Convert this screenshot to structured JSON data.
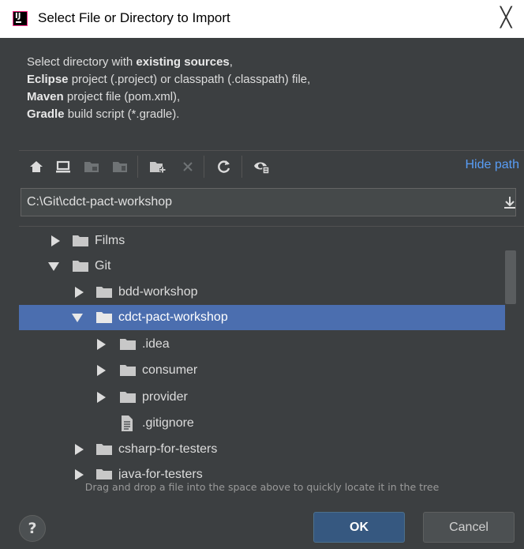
{
  "window": {
    "title": "Select File or Directory to Import",
    "close_glyph": "╳"
  },
  "description": {
    "line1_prefix": "Select directory with ",
    "line1_bold": "existing sources",
    "line1_suffix": ",",
    "line2_bold": "Eclipse",
    "line2_rest": " project (.project) or classpath (.classpath) file,",
    "line3_bold": "Maven",
    "line3_rest": " project file (pom.xml),",
    "line4_bold": "Gradle",
    "line4_rest": " build script (*.gradle)."
  },
  "toolbar": {
    "icons": [
      "home-icon",
      "desktop-icon",
      "project-icon",
      "module-icon",
      "new-folder-icon",
      "delete-icon",
      "refresh-icon",
      "show-hidden-icon"
    ],
    "hide_path_label": "Hide path"
  },
  "path": {
    "value": "C:\\Git\\cdct-pact-workshop"
  },
  "tree": {
    "items": [
      {
        "label": "Films",
        "type": "folder",
        "expanded": false
      },
      {
        "label": "Git",
        "type": "folder",
        "expanded": true
      },
      {
        "label": "bdd-workshop",
        "type": "folder",
        "expanded": false
      },
      {
        "label": "cdct-pact-workshop",
        "type": "folder",
        "expanded": true,
        "selected": true
      },
      {
        "label": ".idea",
        "type": "folder",
        "expanded": false
      },
      {
        "label": "consumer",
        "type": "folder",
        "expanded": false
      },
      {
        "label": "provider",
        "type": "folder",
        "expanded": false
      },
      {
        "label": ".gitignore",
        "type": "file"
      },
      {
        "label": "csharp-for-testers",
        "type": "folder",
        "expanded": false
      },
      {
        "label": "java-for-testers",
        "type": "folder",
        "expanded": false
      }
    ]
  },
  "hint": "Drag and drop a file into the space above to quickly locate it in the tree",
  "buttons": {
    "help": "?",
    "ok": "OK",
    "cancel": "Cancel"
  },
  "colors": {
    "background": "#3c3f41",
    "selection": "#4b6eaf",
    "link": "#589df6",
    "ok_button": "#365880"
  }
}
